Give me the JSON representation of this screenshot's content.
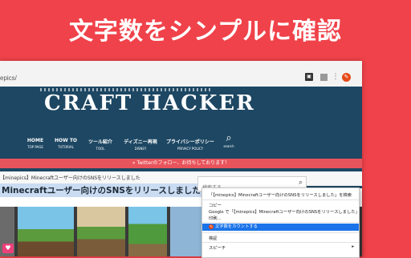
{
  "headline": "文字数をシンプルに確認",
  "browser": {
    "url": "epics/",
    "extensions": [
      "extension-icon",
      "extension-icon",
      "menu-icon",
      "character-count-extension-icon"
    ]
  },
  "site": {
    "logo": "CRAFT HACKER",
    "nav": [
      {
        "label": "HOME",
        "sub": "TOP PAGE"
      },
      {
        "label": "HOW TO",
        "sub": "TUTORIAL"
      },
      {
        "label": "ツール紹介",
        "sub": "TOOL"
      },
      {
        "label": "ディズニー再現",
        "sub": "DISNEY"
      },
      {
        "label": "プライバシーポリシー",
        "sub": "PRIVACY POLICY"
      }
    ],
    "search_sub": "search",
    "notice": "» Twitterのフォロー、お待ちしております！",
    "breadcrumb": "【minepics】Minecraftユーザー向けのSNSをリリースしました",
    "article_title": "Minecraftユーザー向けのSNSをリリースしました",
    "sidebar_search_placeholder": "検索する"
  },
  "context_menu": {
    "items": [
      "「【minepics】Minecraftユーザー向けのSNSをリリースしました」を検索",
      "コピー",
      "Google で「【minepics】Minecraftユーザー向けのSNSをリリースしました」を検索",
      "印刷...",
      "文字数をカウントする",
      "検証",
      "スピーチ"
    ]
  },
  "colors": {
    "background": "#f0424a",
    "header": "#1d4763",
    "highlight": "#1a73e8",
    "selection": "#c9dcf2"
  }
}
